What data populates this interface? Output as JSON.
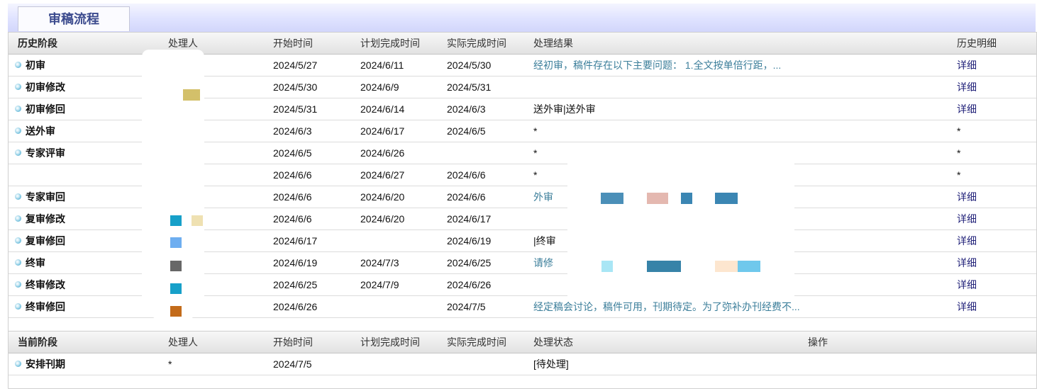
{
  "tab": {
    "label": "审稿流程"
  },
  "history": {
    "headers": [
      "历史阶段",
      "处理人",
      "开始时间",
      "计划完成时间",
      "实际完成时间",
      "处理结果",
      "历史明细"
    ],
    "rows": [
      {
        "stage": "初审",
        "start": "2024/5/27",
        "plan": "2024/6/11",
        "actual": "2024/5/30",
        "result": "经初审，稿件存在以下主要问题： 1.全文按单倍行距，...",
        "result_link": true,
        "detail": "详细"
      },
      {
        "stage": "初审修改",
        "start": "2024/5/30",
        "plan": "2024/6/9",
        "actual": "2024/5/31",
        "result": "",
        "result_link": false,
        "detail": "详细"
      },
      {
        "stage": "初审修回",
        "start": "2024/5/31",
        "plan": "2024/6/14",
        "actual": "2024/6/3",
        "result": "送外审|送外审",
        "result_link": false,
        "detail": "详细"
      },
      {
        "stage": "送外审",
        "start": "2024/6/3",
        "plan": "2024/6/17",
        "actual": "2024/6/5",
        "result": "*",
        "result_link": false,
        "detail": "*"
      },
      {
        "stage": "专家评审",
        "start": "2024/6/5",
        "plan": "2024/6/26",
        "actual": "",
        "result": "*",
        "result_link": false,
        "detail": "*"
      },
      {
        "stage": "",
        "start": "2024/6/6",
        "plan": "2024/6/27",
        "actual": "2024/6/6",
        "result": "*",
        "result_link": false,
        "detail": "*"
      },
      {
        "stage": "专家审回",
        "start": "2024/6/6",
        "plan": "2024/6/20",
        "actual": "2024/6/6",
        "result": "外审",
        "result_link": true,
        "detail": "详细"
      },
      {
        "stage": "复审修改",
        "start": "2024/6/6",
        "plan": "2024/6/20",
        "actual": "2024/6/17",
        "result": "",
        "result_link": false,
        "detail": "详细"
      },
      {
        "stage": "复审修回",
        "start": "2024/6/17",
        "plan": "",
        "actual": "2024/6/19",
        "result": "|终审",
        "result_link": false,
        "detail": "详细"
      },
      {
        "stage": "终审",
        "start": "2024/6/19",
        "plan": "2024/7/3",
        "actual": "2024/6/25",
        "result": "请修",
        "result_link": true,
        "detail": "详细"
      },
      {
        "stage": "终审修改",
        "start": "2024/6/25",
        "plan": "2024/7/9",
        "actual": "2024/6/26",
        "result": "",
        "result_link": false,
        "detail": "详细"
      },
      {
        "stage": "终审修回",
        "start": "2024/6/26",
        "plan": "",
        "actual": "2024/7/5",
        "result": "经定稿会讨论，稿件可用，刊期待定。为了弥补办刊经费不...",
        "result_link": true,
        "detail": "详细"
      }
    ]
  },
  "current": {
    "headers": [
      "当前阶段",
      "处理人",
      "开始时间",
      "计划完成时间",
      "实际完成时间",
      "处理状态",
      "操作"
    ],
    "row": {
      "stage": "安排刊期",
      "handler": "*",
      "start": "2024/7/5",
      "plan": "",
      "actual": "",
      "status": "[待处理]",
      "op": ""
    }
  }
}
